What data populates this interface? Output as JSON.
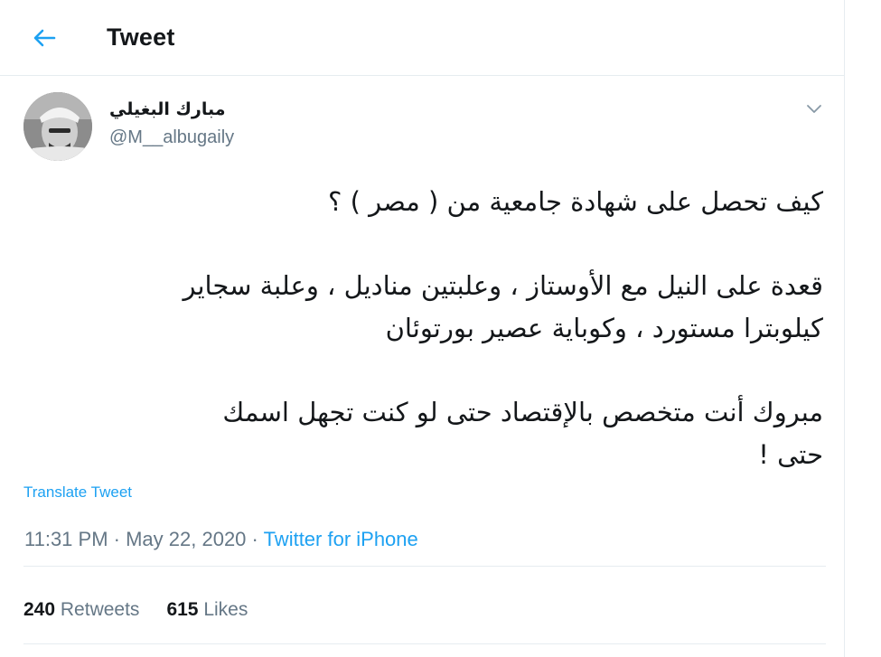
{
  "header": {
    "title": "Tweet",
    "back_icon": "arrow-left-icon"
  },
  "author": {
    "name": "مبارك البغيلي",
    "handle": "@M__albugaily",
    "avatar_icon": "profile-photo"
  },
  "tweet": {
    "lines": [
      "كيف تحصل على شهادة جامعية من ( مصر ) ؟",
      "قعدة على النيل مع الأوستاز ، وعلبتين مناديل ، وعلبة سجاير",
      "كيلوبترا مستورد ، وكوباية عصير بورتوئان",
      "مبروك أنت متخصص بالإقتصاد حتى لو كنت تجهل اسمك",
      "حتى !"
    ],
    "translate_label": "Translate Tweet"
  },
  "meta": {
    "time": "11:31 PM",
    "separator": " · ",
    "date": "May 22, 2020",
    "source": "Twitter for iPhone"
  },
  "stats": {
    "retweets_count": "240",
    "retweets_label": "Retweets",
    "likes_count": "615",
    "likes_label": "Likes"
  },
  "colors": {
    "accent": "#1da1f2",
    "secondary_text": "#657786",
    "border": "#e6ecf0"
  }
}
